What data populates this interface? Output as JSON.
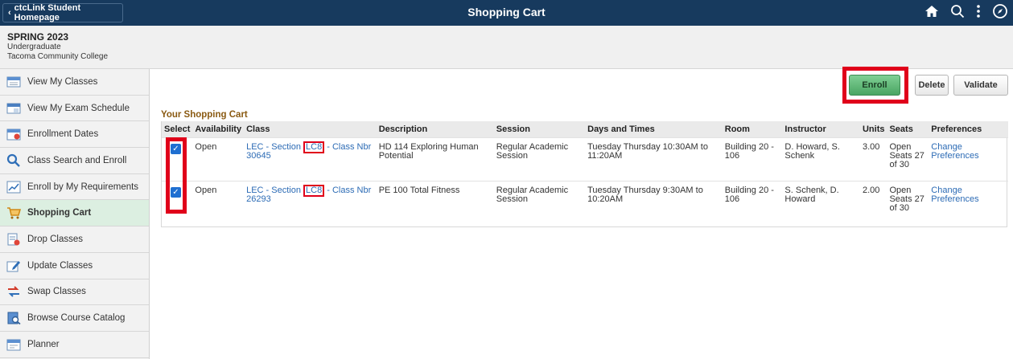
{
  "topbar": {
    "back_label": "ctcLink Student Homepage",
    "title": "Shopping Cart",
    "icons": [
      "home-icon",
      "search-icon",
      "more-icon",
      "navigator-icon"
    ]
  },
  "term": {
    "name": "SPRING 2023",
    "career": "Undergraduate",
    "institution": "Tacoma Community College"
  },
  "sidebar": {
    "items": [
      {
        "label": "View My Classes",
        "icon": "calendar-icon"
      },
      {
        "label": "View My Exam Schedule",
        "icon": "exam-schedule-icon"
      },
      {
        "label": "Enrollment Dates",
        "icon": "enrollment-dates-icon"
      },
      {
        "label": "Class Search and Enroll",
        "icon": "search-icon"
      },
      {
        "label": "Enroll by My Requirements",
        "icon": "chart-icon"
      },
      {
        "label": "Shopping Cart",
        "icon": "cart-icon"
      },
      {
        "label": "Drop Classes",
        "icon": "drop-icon"
      },
      {
        "label": "Update Classes",
        "icon": "edit-icon"
      },
      {
        "label": "Swap Classes",
        "icon": "swap-icon"
      },
      {
        "label": "Browse Course Catalog",
        "icon": "catalog-icon"
      },
      {
        "label": "Planner",
        "icon": "planner-icon"
      }
    ],
    "active_index": 5
  },
  "actions": {
    "enroll": "Enroll",
    "delete": "Delete",
    "validate": "Validate"
  },
  "cart": {
    "title": "Your Shopping Cart",
    "headers": [
      "Select",
      "Availability",
      "Class",
      "Description",
      "Session",
      "Days and Times",
      "Room",
      "Instructor",
      "Units",
      "Seats",
      "Preferences"
    ],
    "rows": [
      {
        "selected": true,
        "availability": "Open",
        "class_prefix": "LEC - Section ",
        "section": "LC8",
        "class_suffix": " - Class Nbr 30645",
        "description": "HD 114 Exploring Human Potential",
        "session": "Regular Academic Session",
        "days_times": "Tuesday Thursday  10:30AM to 11:20AM",
        "room": "Building 20 - 106",
        "instructor": "D. Howard, S. Schenk",
        "units": "3.00",
        "seats": "Open Seats 27 of 30",
        "preferences": "Change Preferences"
      },
      {
        "selected": true,
        "availability": "Open",
        "class_prefix": "LEC - Section ",
        "section": "LC8",
        "class_suffix": " - Class Nbr 26293",
        "description": "PE 100 Total Fitness",
        "session": "Regular Academic Session",
        "days_times": "Tuesday Thursday  9:30AM to 10:20AM",
        "room": "Building 20 - 106",
        "instructor": "S. Schenk, D. Howard",
        "units": "2.00",
        "seats": "Open Seats 27 of 30",
        "preferences": "Change Preferences"
      }
    ]
  },
  "colors": {
    "topbar": "#173a5e",
    "highlight": "#e0001a",
    "enroll_button": "#4aa563",
    "link": "#2c6bb5",
    "cart_title": "#8a5a12"
  }
}
